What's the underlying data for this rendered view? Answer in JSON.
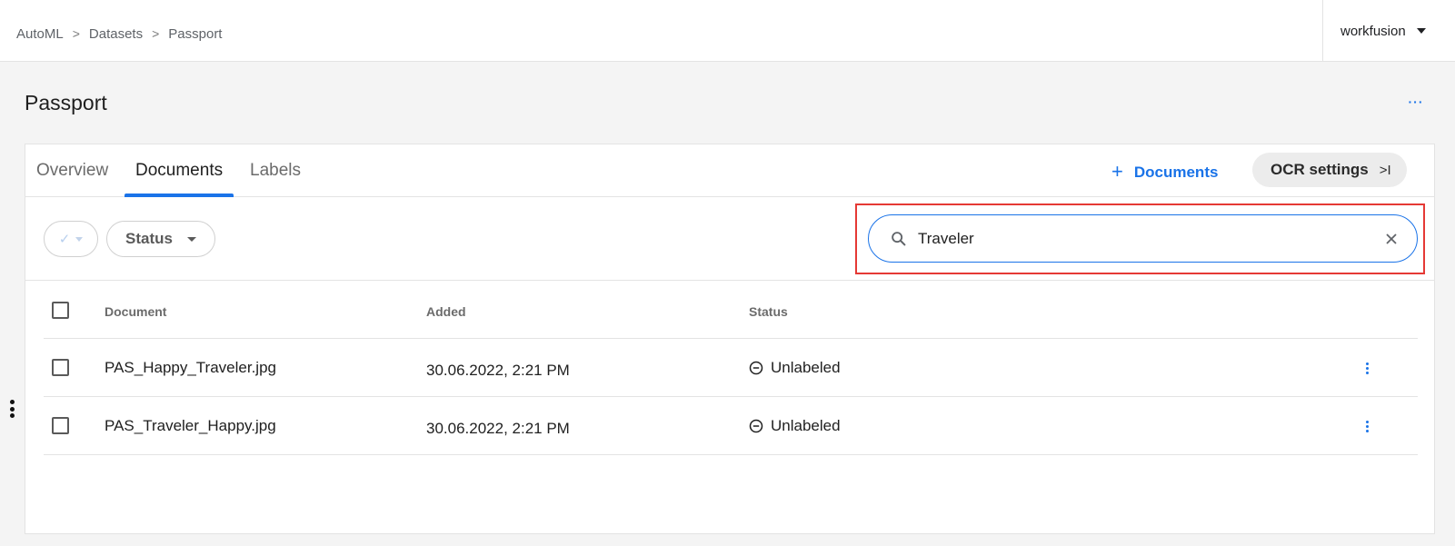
{
  "breadcrumb": {
    "items": [
      "AutoML",
      "Datasets",
      "Passport"
    ]
  },
  "account": {
    "name": "workfusion"
  },
  "page": {
    "title": "Passport",
    "more_label": "···"
  },
  "tabs": [
    {
      "label": "Overview",
      "active": false
    },
    {
      "label": "Documents",
      "active": true
    },
    {
      "label": "Labels",
      "active": false
    }
  ],
  "actions": {
    "add_documents_plus": "+",
    "add_documents_label": "Documents",
    "ocr_settings_label": "OCR settings",
    "ocr_settings_icon": ">I"
  },
  "filters": {
    "check_label": "✓",
    "status_label": "Status"
  },
  "search": {
    "value": "Traveler"
  },
  "table": {
    "columns": [
      "Document",
      "Added",
      "Status"
    ],
    "rows": [
      {
        "document": "PAS_Happy_Traveler.jpg",
        "added": "30.06.2022, 2:21 PM",
        "status": "Unlabeled"
      },
      {
        "document": "PAS_Traveler_Happy.jpg",
        "added": "30.06.2022, 2:21 PM",
        "status": "Unlabeled"
      }
    ]
  },
  "colors": {
    "accent": "#1a73e8",
    "highlight": "#e53935"
  }
}
